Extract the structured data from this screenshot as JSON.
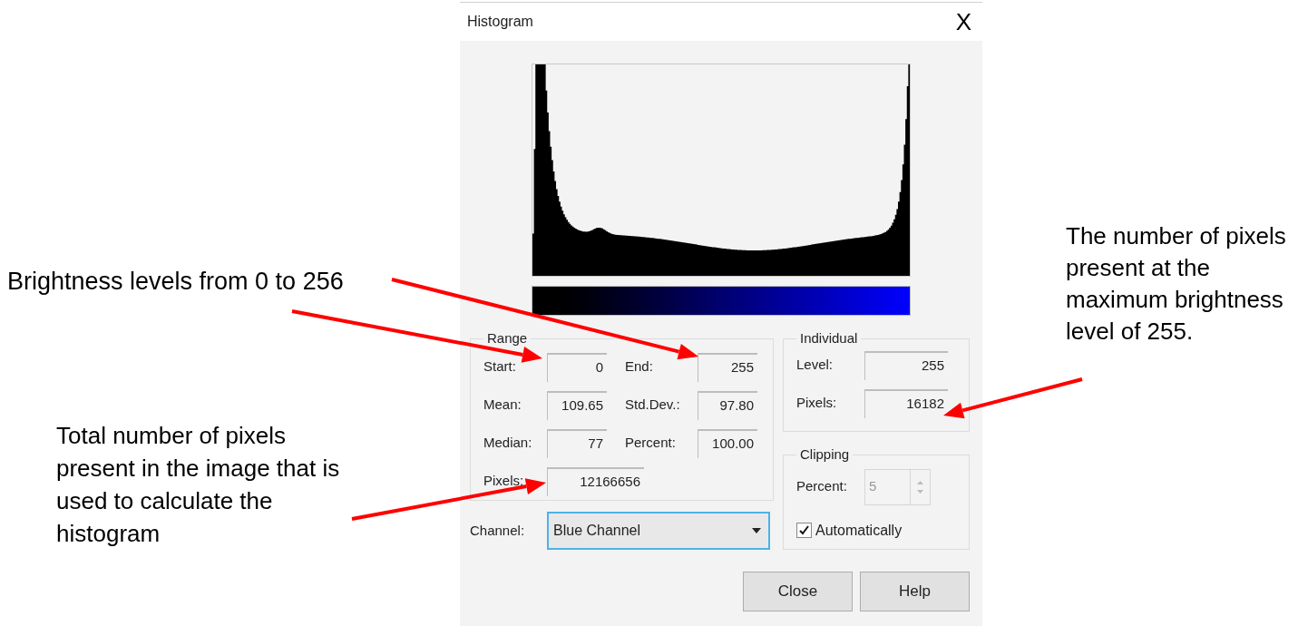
{
  "window": {
    "title": "Histogram",
    "close": "X"
  },
  "range": {
    "title": "Range",
    "fields": [
      {
        "label": "Start:",
        "value": "0"
      },
      {
        "label": "End:",
        "value": "255"
      },
      {
        "label": "Mean:",
        "value": "109.65"
      },
      {
        "label": "Std.Dev.:",
        "value": "97.80"
      },
      {
        "label": "Median:",
        "value": "77"
      },
      {
        "label": "Percent:",
        "value": "100.00"
      },
      {
        "label": "Pixels:",
        "value": "12166656"
      }
    ]
  },
  "individual": {
    "title": "Individual",
    "fields": [
      {
        "label": "Level:",
        "value": "255"
      },
      {
        "label": "Pixels:",
        "value": "16182"
      }
    ]
  },
  "clipping": {
    "title": "Clipping",
    "percent_label": "Percent:",
    "percent_value": "5",
    "disabled": true,
    "checkbox": {
      "label": "Automatically",
      "checked": true
    }
  },
  "channel": {
    "label": "Channel:",
    "value": "Blue Channel",
    "focused": true
  },
  "buttons": [
    "Close",
    "Help"
  ],
  "annotations": [
    {
      "text": "Brightness levels from 0 to 256"
    },
    {
      "text": "Total number of pixels present in the image that is used to calculate the histogram"
    },
    {
      "text": "The number of pixels present at the maximum brightness level of 255."
    }
  ]
}
